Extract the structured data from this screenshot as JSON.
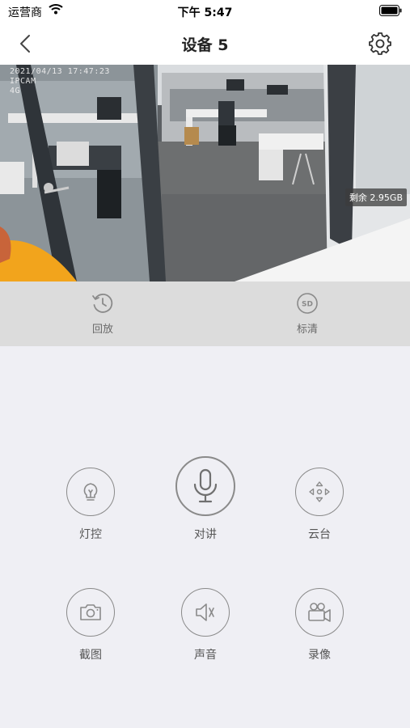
{
  "status_bar": {
    "carrier": "运营商",
    "time": "下午 5:47"
  },
  "nav": {
    "title": "设备 5"
  },
  "video": {
    "osd_lines": [
      "2021/04/13 17:47:23",
      "IPCAM",
      "4G"
    ],
    "storage": "剩余 2.95GB"
  },
  "options": {
    "playback": "回放",
    "quality": "标清",
    "quality_icon_text": "SD"
  },
  "controls": {
    "light": "灯控",
    "talk": "对讲",
    "ptz": "云台",
    "screenshot": "截图",
    "sound": "声音",
    "record": "录像"
  },
  "colors": {
    "icon_stroke": "#8a8a8a",
    "background": "#efeff4",
    "option_bar": "#dcdcdc"
  }
}
